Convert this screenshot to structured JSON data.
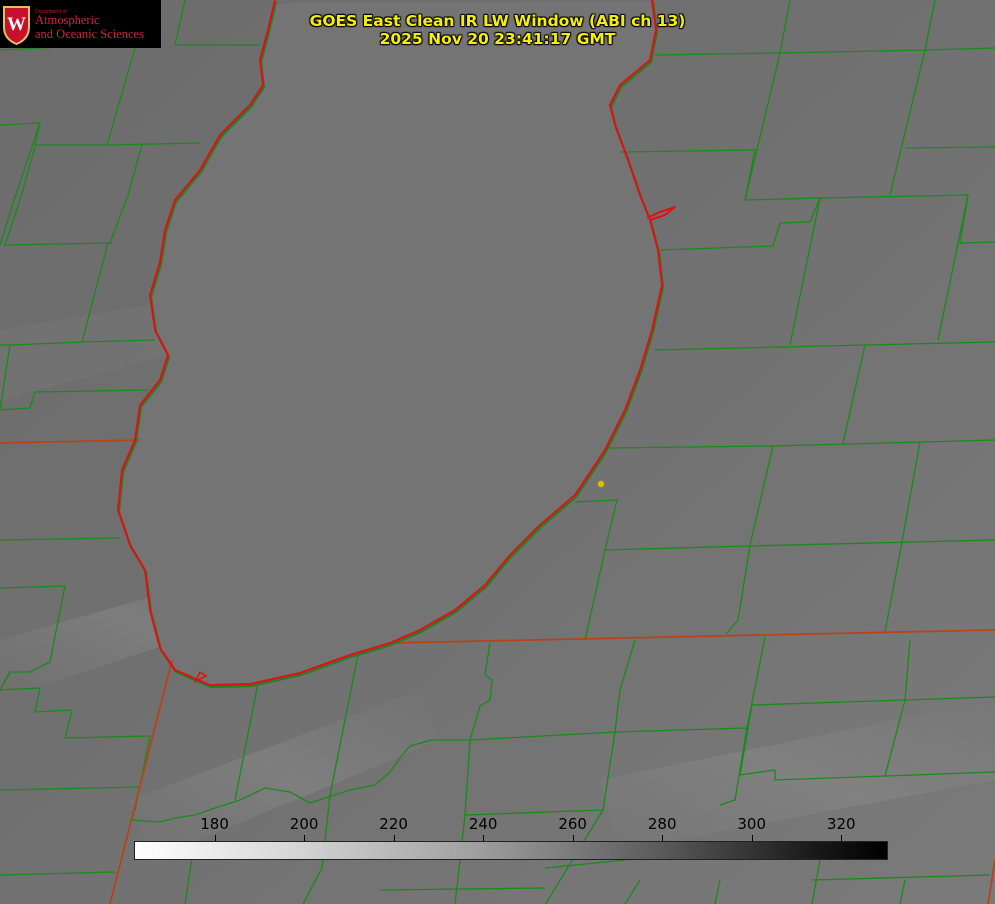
{
  "title": {
    "line1": "GOES East Clean IR LW Window (ABI ch 13)",
    "line2": "2025 Nov 20 23:41:17 GMT"
  },
  "logo": {
    "department": "Department of",
    "line1": "Atmospheric",
    "line2": "and Oceanic Sciences",
    "seal_letter": "W"
  },
  "colorbar": {
    "ticks": [
      "180",
      "200",
      "220",
      "240",
      "260",
      "280",
      "300",
      "320"
    ],
    "tick_values": [
      180,
      200,
      220,
      240,
      260,
      280,
      300,
      320
    ],
    "range": [
      162,
      330
    ],
    "colormap": "grayscale inverted (white = cold, black = warm)"
  },
  "colors": {
    "county_lines": "#1a8a1a",
    "state_lines": "#b8431a",
    "lake_outline": "#e01010",
    "title_text": "#f5f000",
    "point_marker": "#d6c000",
    "lake_fill": "#767676",
    "land_fill": "#707070"
  },
  "map": {
    "feature": "lake-michigan-southern-basin",
    "marker": "yellow-point"
  }
}
